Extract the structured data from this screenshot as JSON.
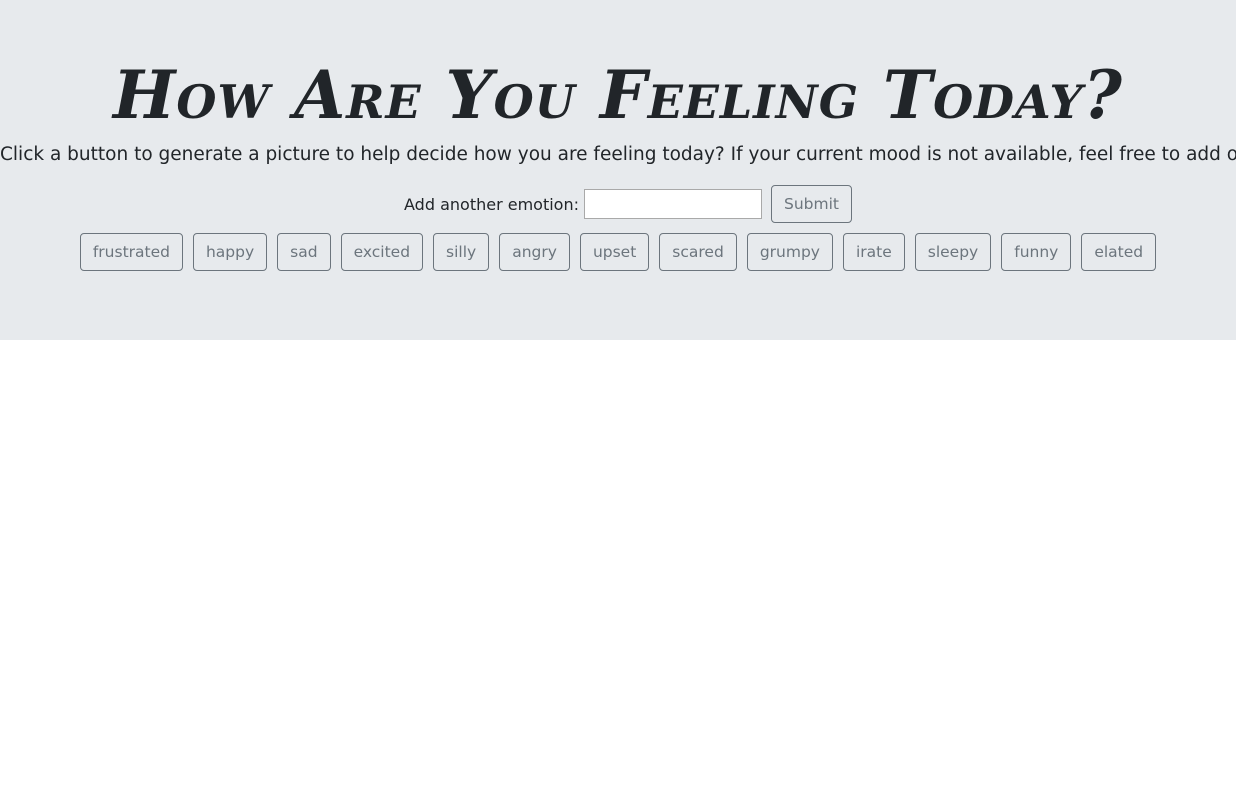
{
  "header": {
    "title": "How Are You Feeling Today?",
    "subtitle": "Click a button to generate a picture to help decide how you are feeling today? If your current mood is not available, feel free to add one!"
  },
  "add_form": {
    "label": "Add another emotion:",
    "input_value": "",
    "submit_label": "Submit"
  },
  "emotions": [
    "frustrated",
    "happy",
    "sad",
    "excited",
    "silly",
    "angry",
    "upset",
    "scared",
    "grumpy",
    "irate",
    "sleepy",
    "funny",
    "elated"
  ],
  "colors": {
    "jumbotron_bg": "#e7eaed",
    "button_outline": "#6c757d",
    "text": "#212529"
  }
}
